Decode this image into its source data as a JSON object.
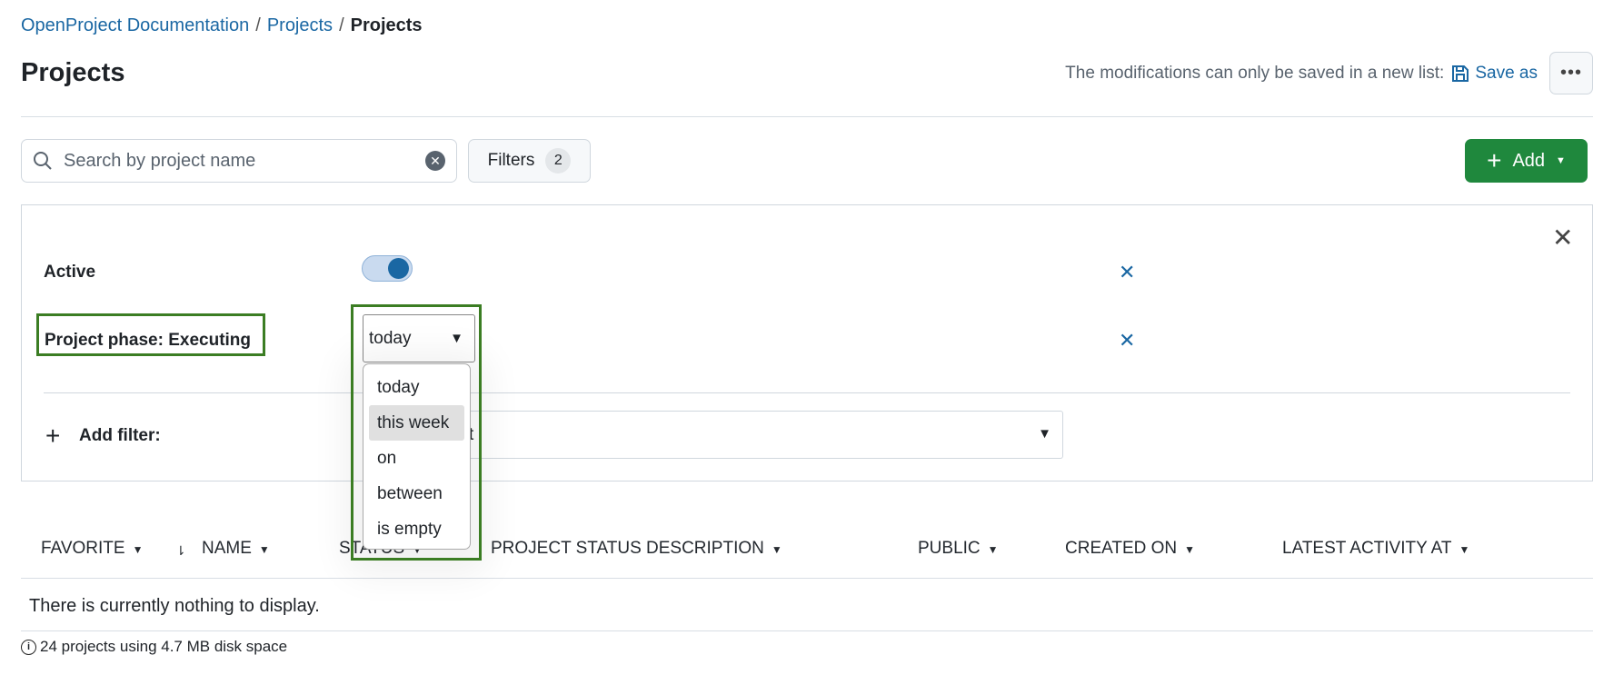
{
  "breadcrumb": {
    "items": [
      "OpenProject Documentation",
      "Projects"
    ],
    "current": "Projects"
  },
  "title": "Projects",
  "save": {
    "message": "The modifications can only be saved in a new list:",
    "save_as": "Save as",
    "more": "•••"
  },
  "search": {
    "placeholder": "Search by project name"
  },
  "filters": {
    "label": "Filters",
    "count": "2"
  },
  "add": {
    "label": "Add"
  },
  "filter_panel": {
    "active": {
      "label": "Active",
      "value": true
    },
    "phase": {
      "label": "Project phase: Executing",
      "selected": "today",
      "options": [
        "today",
        "this week",
        "on",
        "between",
        "is empty"
      ],
      "highlighted": "this week"
    },
    "add_filter": {
      "label": "Add filter:",
      "select_visible_text": "t"
    }
  },
  "table": {
    "columns": [
      "FAVORITE",
      "NAME",
      "STATUS",
      "PROJECT STATUS DESCRIPTION",
      "PUBLIC",
      "CREATED ON",
      "LATEST ACTIVITY AT"
    ],
    "empty": "There is currently nothing to display."
  },
  "footer": {
    "text": "24 projects using 4.7 MB disk space"
  },
  "colors": {
    "link": "#1a67a3",
    "primary": "#1f883d",
    "highlight_box": "#3b7d23"
  }
}
